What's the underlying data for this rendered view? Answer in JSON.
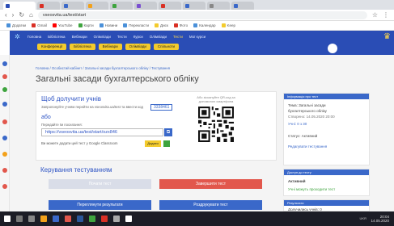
{
  "colors": {
    "brand": "#2a4db5",
    "accent": "#3a68c9",
    "danger": "#e2574c",
    "ok": "#3ea43e",
    "highlight": "#f3cb2d"
  },
  "browser": {
    "tab_title": "",
    "url": "vseosvita.ua/test/start",
    "nav_icons": [
      "back-arrow-icon",
      "forward-arrow-icon",
      "reload-icon",
      "home-icon"
    ],
    "bookmarks": [
      "Додатки",
      "Gmail",
      "YouTube",
      "Карти",
      "Новини",
      "Перекласти",
      "Диск",
      "Фото",
      "Календар",
      "Keep"
    ]
  },
  "site": {
    "nav": [
      "Головна",
      "Бібліотека",
      "Вебінари",
      "Олімпіади",
      "Тести",
      "Курси",
      "Олімпіади",
      "Тести",
      "Мої курси"
    ],
    "tools": [
      "Конференції",
      "Бібліотека",
      "Вебінари",
      "Олімпіади",
      "Спільноти"
    ]
  },
  "breadcrumb": "Головна / Особистий кабінет / Загальні засади бухгалтерського обліку / Тестування",
  "page_title": "Загальні засади бухгалтерського обліку",
  "invite": {
    "title": "Щоб долучити учнів",
    "line1": "Запропонуйте учням перейти на vseosvita.ua/test та ввести код",
    "code": "3338461",
    "or": "або",
    "hint": "Передайте їм посилання:",
    "link": "https://vseosvita.ua/test/start/ozx846",
    "classroom_text": "Ви можете додати цей тест у Google Classroom",
    "share_label": "Додати",
    "qr_caption": "Або зіскануйте QR-код за допомогою смартфона"
  },
  "management": {
    "title": "Керування тестуванням",
    "buttons": [
      "Почати тест",
      "Завершити тест",
      "Переглянути результати",
      "Роздрукувати тест"
    ]
  },
  "info_card": {
    "header": "Інформація про тест",
    "lines": [
      "Тема: Загальні засади",
      "бухгалтерського обліку",
      "Створено: 14.05.2020 20:00",
      "Учні: 0 з 30",
      "Статус: Активний",
      "Редагувати тестування"
    ],
    "status_badge": "Активний"
  },
  "access_card": {
    "header": "Доступ до тесту",
    "line1": "Активний",
    "line2": "Учні можуть проходити тест"
  },
  "results_card": {
    "header": "Результати",
    "line1": "Долучились учнів: 0"
  },
  "taskbar": {
    "time": "20:04",
    "date": "14.05.2020",
    "lang": "UKR"
  }
}
